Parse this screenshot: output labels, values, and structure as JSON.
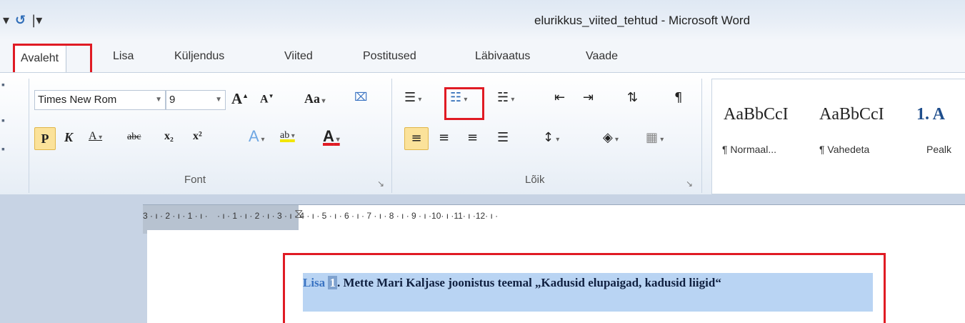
{
  "window": {
    "title": "elurikkus_viited_tehtud  -  Microsoft Word"
  },
  "quick_access": {
    "undo_icon": "undo-icon",
    "customize_icon": "customize-qat-icon"
  },
  "tabs": [
    {
      "label": "Avaleht",
      "active": true
    },
    {
      "label": "Lisa"
    },
    {
      "label": "Küljendus"
    },
    {
      "label": "Viited"
    },
    {
      "label": "Postitused"
    },
    {
      "label": "Läbivaatus"
    },
    {
      "label": "Vaade"
    }
  ],
  "font_group": {
    "label": "Font",
    "font_name": "Times New Rom",
    "font_size": "9",
    "grow_label": "A",
    "shrink_label": "A",
    "case_label": "Aa",
    "bold_label": "P",
    "italic_label": "K",
    "underline_label": "A",
    "strike_label": "abc",
    "subscript_label": "x₂",
    "superscript_label": "x²",
    "effects_label": "A",
    "highlight_label": "ab",
    "color_label": "A"
  },
  "paragraph_group": {
    "label": "Lõik",
    "pilcrow": "¶"
  },
  "styles": [
    {
      "sample": "AaBbCcI",
      "name": "¶ Normaal..."
    },
    {
      "sample": "AaBbCcI",
      "name": "¶ Vahedeta"
    },
    {
      "sample": "1. A",
      "name": "Pealk"
    }
  ],
  "ruler": {
    "numbers": "3 · ı · 2 · ı · 1 · ı ·    · ı · 1 · ı · 2 · ı · 3 · ı · 4 · ı · 5 · ı · 6 · ı · 7 · ı · 8 · ı · 9 · ı ·10· ı ·11· ı ·12· ı ·"
  },
  "document": {
    "heading_prefix": "Lisa",
    "heading_number": "1",
    "heading_rest": ". Mette Mari Kaljase joonistus teemal „Kadusid elupaigad, kadusid liigid“"
  },
  "colors": {
    "annotation": "#e01b24",
    "selection": "#b9d4f3"
  }
}
